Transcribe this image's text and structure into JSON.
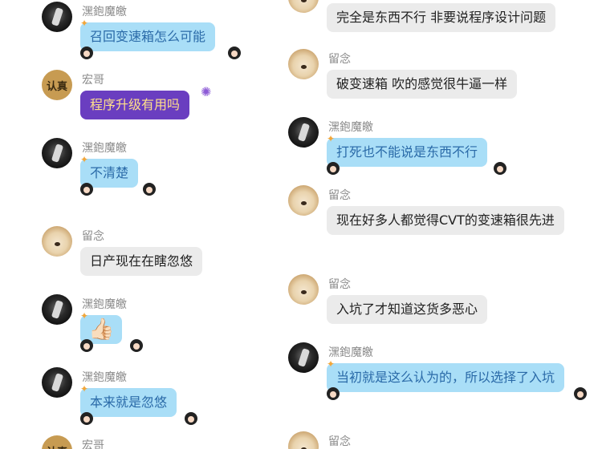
{
  "names": {
    "moyi": "潶鉋魔皦",
    "hongge": "宏哥",
    "liunian": "留念"
  },
  "badge_text": "认真",
  "left_messages": [
    {
      "name_key": "moyi",
      "text": "召回变速箱怎么可能"
    },
    {
      "name_key": "hongge",
      "text": "程序升级有用吗"
    },
    {
      "name_key": "moyi",
      "text": "不清楚"
    },
    {
      "name_key": "liunian",
      "text": "日产现在在瞎忽悠"
    },
    {
      "name_key": "moyi",
      "emoji": "👍🏻"
    },
    {
      "name_key": "moyi",
      "text": "本来就是忽悠"
    },
    {
      "name_key": "hongge"
    }
  ],
  "right_messages": [
    {
      "text": "完全是东西不行 非要说程序设计问题"
    },
    {
      "name_key": "liunian",
      "text": "破变速箱   吹的感觉很牛逼一样"
    },
    {
      "name_key": "moyi",
      "text": "打死也不能说是东西不行"
    },
    {
      "name_key": "liunian",
      "text": "现在好多人都觉得CVT的变速箱很先进"
    },
    {
      "name_key": "liunian",
      "text": "入坑了才知道这货多恶心"
    },
    {
      "name_key": "moyi",
      "text": "当初就是这么认为的，所以选择了入坑"
    },
    {
      "name_key": "liunian"
    }
  ],
  "colors": {
    "gray_bubble": "#ebebeb",
    "blue_bubble": "#a9def7",
    "purple_bubble": "#6a3ec0",
    "name_text": "#8a8a8a"
  }
}
